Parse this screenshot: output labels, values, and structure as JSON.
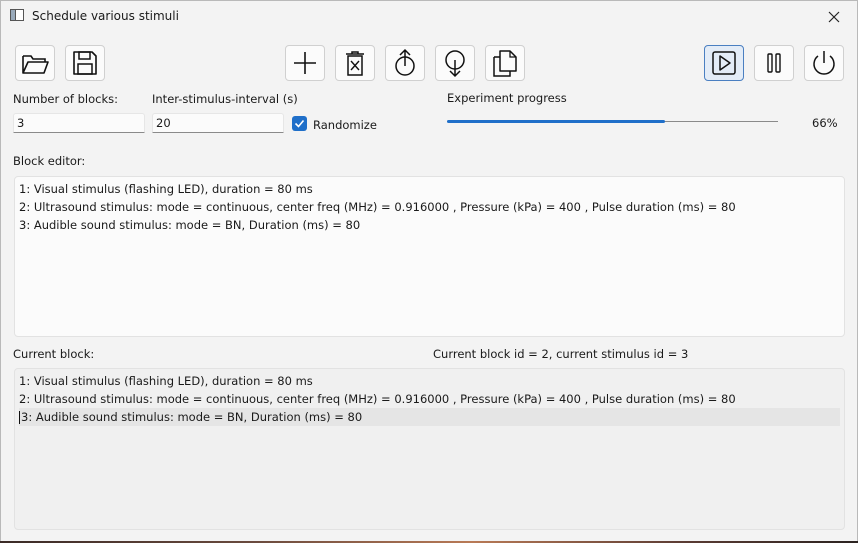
{
  "window": {
    "title": "Schedule various stimuli",
    "close_glyph": "✕"
  },
  "toolbar": {
    "open_icon": "folder-open-icon",
    "save_icon": "save-icon",
    "add_icon": "plus-icon",
    "delete_icon": "delete-icon",
    "move_up_icon": "move-up-icon",
    "move_down_icon": "move-down-icon",
    "copy_icon": "copy-icon",
    "play_icon": "play-icon",
    "pause_icon": "pause-icon",
    "power_icon": "power-icon"
  },
  "settings": {
    "num_blocks_label": "Number of blocks:",
    "num_blocks_value": "3",
    "isi_label": "Inter-stimulus-interval (s)",
    "isi_value": "20",
    "randomize_label": "Randomize",
    "randomize_checked": true
  },
  "progress": {
    "label": "Experiment progress",
    "percent_text": "66%",
    "fraction": 0.66,
    "color": "#1f6fc9"
  },
  "block_editor": {
    "label": "Block editor:",
    "lines": [
      "1: Visual stimulus (flashing LED), duration = 80 ms",
      "2: Ultrasound stimulus: mode = continuous, center freq (MHz) = 0.916000 , Pressure (kPa) = 400 , Pulse duration (ms) = 80",
      "3: Audible sound stimulus: mode = BN, Duration (ms) = 80"
    ]
  },
  "current_block": {
    "label": "Current block:",
    "status": "Current block id = 2, current stimulus id = 3",
    "lines": [
      "1: Visual stimulus (flashing LED), duration = 80 ms",
      "2: Ultrasound stimulus: mode = continuous, center freq (MHz) = 0.916000 , Pressure (kPa) = 400 , Pulse duration (ms) = 80",
      "3: Audible sound stimulus: mode = BN, Duration (ms) = 80"
    ],
    "highlighted_line": 2
  }
}
